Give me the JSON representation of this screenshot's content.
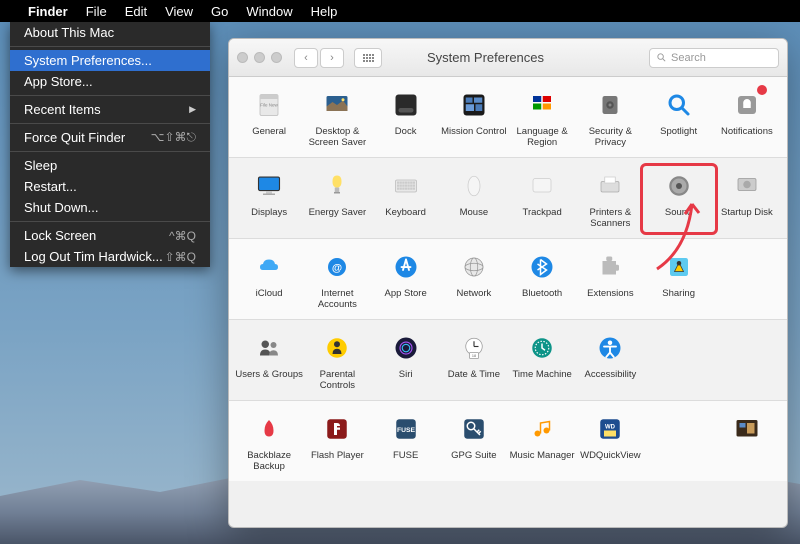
{
  "menubar": {
    "app": "Finder",
    "items": [
      "File",
      "Edit",
      "View",
      "Go",
      "Window",
      "Help"
    ]
  },
  "apple_menu": {
    "items": [
      {
        "label": "About This Mac",
        "type": "item"
      },
      {
        "type": "sep"
      },
      {
        "label": "System Preferences...",
        "type": "item",
        "highlighted": true
      },
      {
        "label": "App Store...",
        "type": "item"
      },
      {
        "type": "sep"
      },
      {
        "label": "Recent Items",
        "type": "submenu"
      },
      {
        "type": "sep"
      },
      {
        "label": "Force Quit Finder",
        "shortcut": "⌥⇧⌘⎋",
        "type": "item"
      },
      {
        "type": "sep"
      },
      {
        "label": "Sleep",
        "type": "item"
      },
      {
        "label": "Restart...",
        "type": "item"
      },
      {
        "label": "Shut Down...",
        "type": "item"
      },
      {
        "type": "sep"
      },
      {
        "label": "Lock Screen",
        "shortcut": "^⌘Q",
        "type": "item"
      },
      {
        "label": "Log Out Tim Hardwick...",
        "shortcut": "⇧⌘Q",
        "type": "item"
      }
    ]
  },
  "window": {
    "title": "System Preferences",
    "search_placeholder": "Search"
  },
  "prefs": {
    "rows": [
      [
        {
          "id": "general",
          "label": "General"
        },
        {
          "id": "desktop-screensaver",
          "label": "Desktop & Screen Saver"
        },
        {
          "id": "dock",
          "label": "Dock"
        },
        {
          "id": "mission-control",
          "label": "Mission Control"
        },
        {
          "id": "language-region",
          "label": "Language & Region"
        },
        {
          "id": "security-privacy",
          "label": "Security & Privacy"
        },
        {
          "id": "spotlight",
          "label": "Spotlight"
        },
        {
          "id": "notifications",
          "label": "Notifications",
          "badge": true
        }
      ],
      [
        {
          "id": "displays",
          "label": "Displays"
        },
        {
          "id": "energy-saver",
          "label": "Energy Saver"
        },
        {
          "id": "keyboard",
          "label": "Keyboard"
        },
        {
          "id": "mouse",
          "label": "Mouse"
        },
        {
          "id": "trackpad",
          "label": "Trackpad"
        },
        {
          "id": "printers-scanners",
          "label": "Printers & Scanners"
        },
        {
          "id": "sound",
          "label": "Sound",
          "highlighted": true
        },
        {
          "id": "startup-disk",
          "label": "Startup Disk"
        }
      ],
      [
        {
          "id": "icloud",
          "label": "iCloud"
        },
        {
          "id": "internet-accounts",
          "label": "Internet Accounts"
        },
        {
          "id": "app-store",
          "label": "App Store"
        },
        {
          "id": "network",
          "label": "Network"
        },
        {
          "id": "bluetooth",
          "label": "Bluetooth"
        },
        {
          "id": "extensions",
          "label": "Extensions"
        },
        {
          "id": "sharing",
          "label": "Sharing"
        },
        null
      ],
      [
        {
          "id": "users-groups",
          "label": "Users & Groups"
        },
        {
          "id": "parental-controls",
          "label": "Parental Controls"
        },
        {
          "id": "siri",
          "label": "Siri"
        },
        {
          "id": "date-time",
          "label": "Date & Time"
        },
        {
          "id": "time-machine",
          "label": "Time Machine"
        },
        {
          "id": "accessibility",
          "label": "Accessibility"
        },
        null,
        null
      ],
      [
        {
          "id": "backblaze",
          "label": "Backblaze Backup"
        },
        {
          "id": "flash-player",
          "label": "Flash Player"
        },
        {
          "id": "fuse",
          "label": "FUSE"
        },
        {
          "id": "gpg-suite",
          "label": "GPG Suite"
        },
        {
          "id": "music-manager",
          "label": "Music Manager"
        },
        {
          "id": "wdquickview",
          "label": "WDQuickView"
        },
        null,
        {
          "id": "unknown-pref",
          "label": ""
        }
      ]
    ]
  }
}
